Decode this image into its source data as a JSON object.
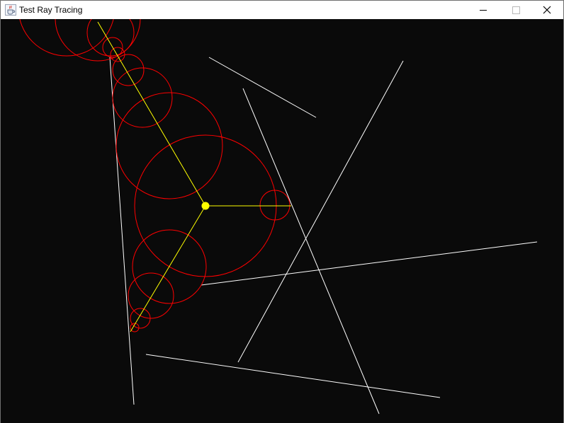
{
  "window": {
    "title": "Test Ray Tracing",
    "icon": "java-coffee-cup-icon",
    "controls": [
      "minimize-icon",
      "maximize-icon",
      "close-icon"
    ]
  },
  "scene": {
    "background_color": "#0a0a0a",
    "wall_color": "#ffffff",
    "ray_color": "#ffff00",
    "circle_color": "#ff0000",
    "source_color": "#ffff00"
  }
}
